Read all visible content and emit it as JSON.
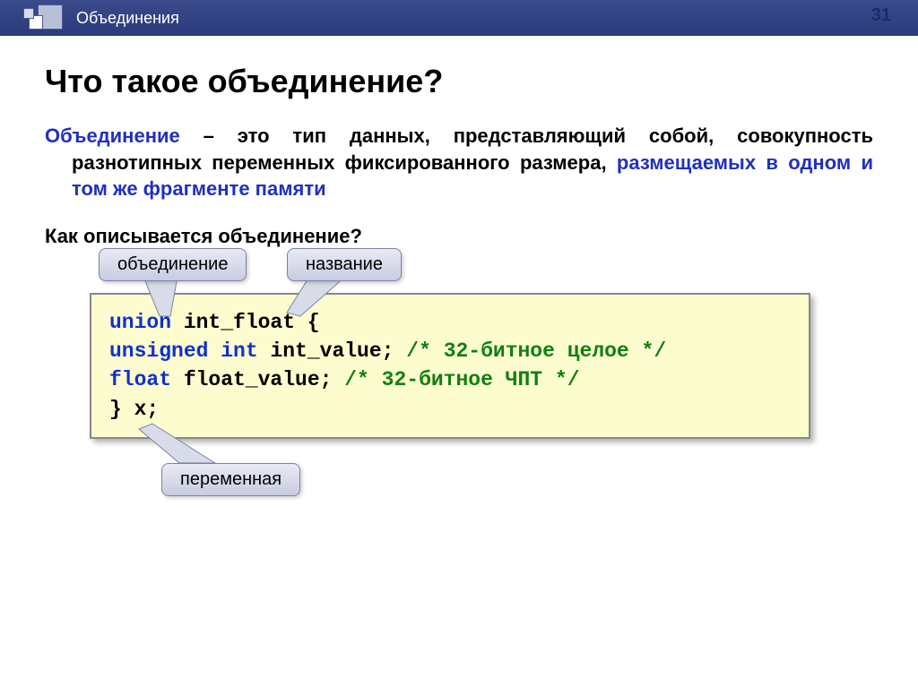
{
  "header": {
    "title": "Объединения",
    "page_number": "31"
  },
  "main_title": "Что такое объединение?",
  "definition": {
    "term": "Объединение",
    "body": " – это тип данных, представляющий собой, совокупность разнотипных переменных фиксированного размера, ",
    "highlight": "размещаемых в одном и том же фрагменте памяти"
  },
  "subheading": "Как описывается объединение?",
  "callouts": {
    "union": "объединение",
    "name": "название",
    "variable": "переменная"
  },
  "code": {
    "l1_kw": "union",
    "l1_id": " int_float {",
    "l2_pad": "  ",
    "l2_kw": "unsigned int",
    "l2_id": " int_value; ",
    "l2_cm": "/* 32-битное целое */",
    "l3_pad": "  ",
    "l3_kw": "float",
    "l3_id": " float_value;      ",
    "l3_cm": "/* 32-битное ЧПТ */",
    "l4": "} x;"
  }
}
